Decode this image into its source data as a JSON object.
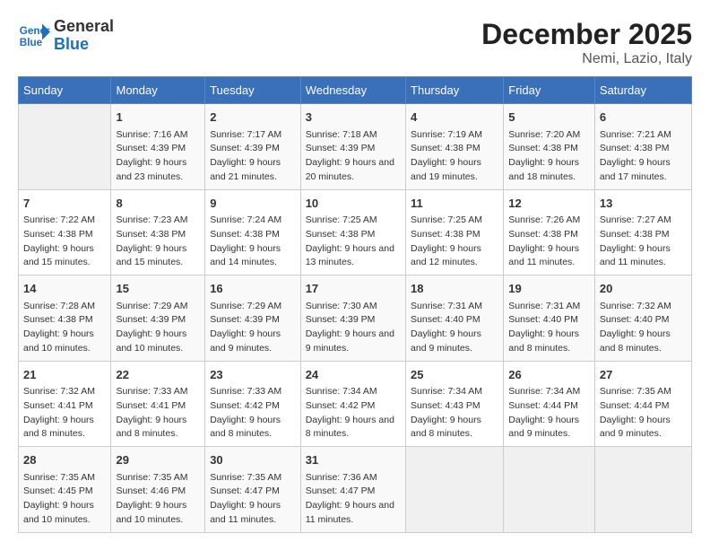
{
  "header": {
    "logo_line1": "General",
    "logo_line2": "Blue",
    "month": "December 2025",
    "location": "Nemi, Lazio, Italy"
  },
  "days_of_week": [
    "Sunday",
    "Monday",
    "Tuesday",
    "Wednesday",
    "Thursday",
    "Friday",
    "Saturday"
  ],
  "weeks": [
    [
      {
        "num": "",
        "empty": true
      },
      {
        "num": "1",
        "sunrise": "7:16 AM",
        "sunset": "4:39 PM",
        "daylight": "9 hours and 23 minutes."
      },
      {
        "num": "2",
        "sunrise": "7:17 AM",
        "sunset": "4:39 PM",
        "daylight": "9 hours and 21 minutes."
      },
      {
        "num": "3",
        "sunrise": "7:18 AM",
        "sunset": "4:39 PM",
        "daylight": "9 hours and 20 minutes."
      },
      {
        "num": "4",
        "sunrise": "7:19 AM",
        "sunset": "4:38 PM",
        "daylight": "9 hours and 19 minutes."
      },
      {
        "num": "5",
        "sunrise": "7:20 AM",
        "sunset": "4:38 PM",
        "daylight": "9 hours and 18 minutes."
      },
      {
        "num": "6",
        "sunrise": "7:21 AM",
        "sunset": "4:38 PM",
        "daylight": "9 hours and 17 minutes."
      }
    ],
    [
      {
        "num": "7",
        "sunrise": "7:22 AM",
        "sunset": "4:38 PM",
        "daylight": "9 hours and 15 minutes."
      },
      {
        "num": "8",
        "sunrise": "7:23 AM",
        "sunset": "4:38 PM",
        "daylight": "9 hours and 15 minutes."
      },
      {
        "num": "9",
        "sunrise": "7:24 AM",
        "sunset": "4:38 PM",
        "daylight": "9 hours and 14 minutes."
      },
      {
        "num": "10",
        "sunrise": "7:25 AM",
        "sunset": "4:38 PM",
        "daylight": "9 hours and 13 minutes."
      },
      {
        "num": "11",
        "sunrise": "7:25 AM",
        "sunset": "4:38 PM",
        "daylight": "9 hours and 12 minutes."
      },
      {
        "num": "12",
        "sunrise": "7:26 AM",
        "sunset": "4:38 PM",
        "daylight": "9 hours and 11 minutes."
      },
      {
        "num": "13",
        "sunrise": "7:27 AM",
        "sunset": "4:38 PM",
        "daylight": "9 hours and 11 minutes."
      }
    ],
    [
      {
        "num": "14",
        "sunrise": "7:28 AM",
        "sunset": "4:38 PM",
        "daylight": "9 hours and 10 minutes."
      },
      {
        "num": "15",
        "sunrise": "7:29 AM",
        "sunset": "4:39 PM",
        "daylight": "9 hours and 10 minutes."
      },
      {
        "num": "16",
        "sunrise": "7:29 AM",
        "sunset": "4:39 PM",
        "daylight": "9 hours and 9 minutes."
      },
      {
        "num": "17",
        "sunrise": "7:30 AM",
        "sunset": "4:39 PM",
        "daylight": "9 hours and 9 minutes."
      },
      {
        "num": "18",
        "sunrise": "7:31 AM",
        "sunset": "4:40 PM",
        "daylight": "9 hours and 9 minutes."
      },
      {
        "num": "19",
        "sunrise": "7:31 AM",
        "sunset": "4:40 PM",
        "daylight": "9 hours and 8 minutes."
      },
      {
        "num": "20",
        "sunrise": "7:32 AM",
        "sunset": "4:40 PM",
        "daylight": "9 hours and 8 minutes."
      }
    ],
    [
      {
        "num": "21",
        "sunrise": "7:32 AM",
        "sunset": "4:41 PM",
        "daylight": "9 hours and 8 minutes."
      },
      {
        "num": "22",
        "sunrise": "7:33 AM",
        "sunset": "4:41 PM",
        "daylight": "9 hours and 8 minutes."
      },
      {
        "num": "23",
        "sunrise": "7:33 AM",
        "sunset": "4:42 PM",
        "daylight": "9 hours and 8 minutes."
      },
      {
        "num": "24",
        "sunrise": "7:34 AM",
        "sunset": "4:42 PM",
        "daylight": "9 hours and 8 minutes."
      },
      {
        "num": "25",
        "sunrise": "7:34 AM",
        "sunset": "4:43 PM",
        "daylight": "9 hours and 8 minutes."
      },
      {
        "num": "26",
        "sunrise": "7:34 AM",
        "sunset": "4:44 PM",
        "daylight": "9 hours and 9 minutes."
      },
      {
        "num": "27",
        "sunrise": "7:35 AM",
        "sunset": "4:44 PM",
        "daylight": "9 hours and 9 minutes."
      }
    ],
    [
      {
        "num": "28",
        "sunrise": "7:35 AM",
        "sunset": "4:45 PM",
        "daylight": "9 hours and 10 minutes."
      },
      {
        "num": "29",
        "sunrise": "7:35 AM",
        "sunset": "4:46 PM",
        "daylight": "9 hours and 10 minutes."
      },
      {
        "num": "30",
        "sunrise": "7:35 AM",
        "sunset": "4:47 PM",
        "daylight": "9 hours and 11 minutes."
      },
      {
        "num": "31",
        "sunrise": "7:36 AM",
        "sunset": "4:47 PM",
        "daylight": "9 hours and 11 minutes."
      },
      {
        "num": "",
        "empty": true
      },
      {
        "num": "",
        "empty": true
      },
      {
        "num": "",
        "empty": true
      }
    ]
  ]
}
